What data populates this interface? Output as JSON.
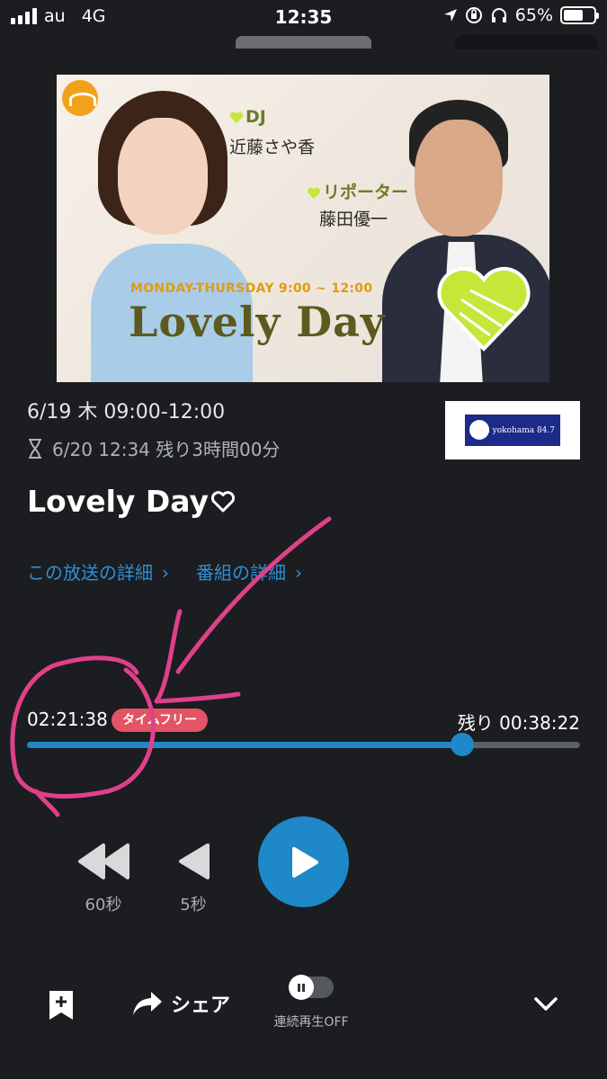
{
  "status_bar": {
    "carrier": "au",
    "network": "4G",
    "time": "12:35",
    "battery": "65%",
    "battery_level": 0.65
  },
  "hero": {
    "dj_label": "DJ",
    "dj_name": "近藤さや香",
    "reporter_label": "リポーター",
    "reporter_name": "藤田優一",
    "schedule": "MONDAY-THURSDAY 9:00 ~ 12:00",
    "show_title": "Lovely Day",
    "colors": {
      "logo_orange": "#f2a21a",
      "heart_green": "#c6e63a"
    }
  },
  "program": {
    "date": "6/19 木 09:00-12:00",
    "expiry": "6/20 12:34 残り3時間00分",
    "title": "Lovely Day",
    "station_logo_text": "Fm yokohama 84.7"
  },
  "links": {
    "broadcast_details": "この放送の詳細",
    "program_details": "番組の詳細"
  },
  "player": {
    "elapsed": "02:21:38",
    "badge": "タイムフリー",
    "remaining": "残り 00:38:22",
    "progress": 0.787,
    "rewind_60_label": "60秒",
    "rewind_5_label": "5秒",
    "accent_color": "#1e88c8",
    "badge_color": "#e35464"
  },
  "bottom": {
    "share_label": "シェア",
    "continuous_play_label": "連続再生OFF"
  },
  "annotation_color": "#e0408a"
}
